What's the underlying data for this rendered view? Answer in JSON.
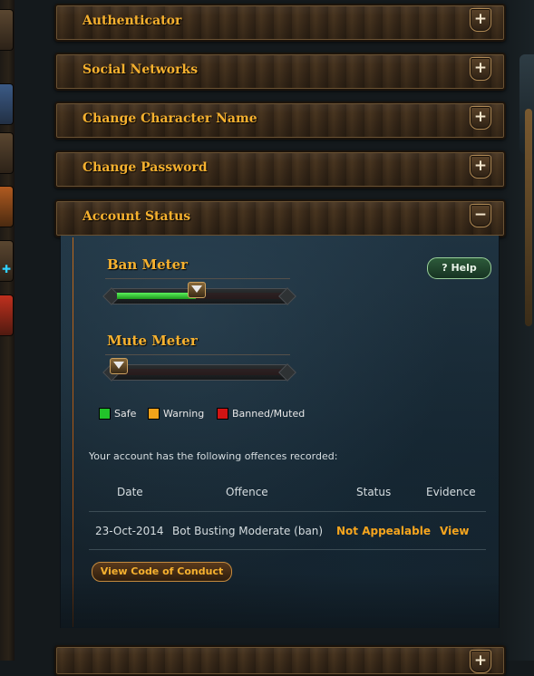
{
  "accordion": [
    {
      "title": "Authenticator",
      "toggle": "+"
    },
    {
      "title": "Social Networks",
      "toggle": "+"
    },
    {
      "title": "Change Character Name",
      "toggle": "+"
    },
    {
      "title": "Change Password",
      "toggle": "+"
    },
    {
      "title": "Account Status",
      "toggle": "−"
    },
    {
      "title": "",
      "toggle": "+"
    }
  ],
  "account_status": {
    "ban_meter": {
      "label": "Ban Meter",
      "level_percent": 48
    },
    "mute_meter": {
      "label": "Mute Meter",
      "level_percent": 0
    },
    "help_label": "? Help",
    "legend": [
      {
        "label": "Safe",
        "color": "#22c22a"
      },
      {
        "label": "Warning",
        "color": "#f2a21a"
      },
      {
        "label": "Banned/Muted",
        "color": "#d21414"
      }
    ],
    "offences_caption": "Your account has the following offences recorded:",
    "table": {
      "columns": [
        "Date",
        "Offence",
        "Status",
        "Evidence"
      ],
      "rows": [
        {
          "date": "23-Oct-2014",
          "offence": "Bot Busting Moderate (ban)",
          "status": "Not Appealable",
          "evidence": "View"
        }
      ]
    },
    "coc_button": "View Code of Conduct"
  },
  "colors": {
    "accent": "#f6b12f",
    "panel": "#1b2c38"
  }
}
